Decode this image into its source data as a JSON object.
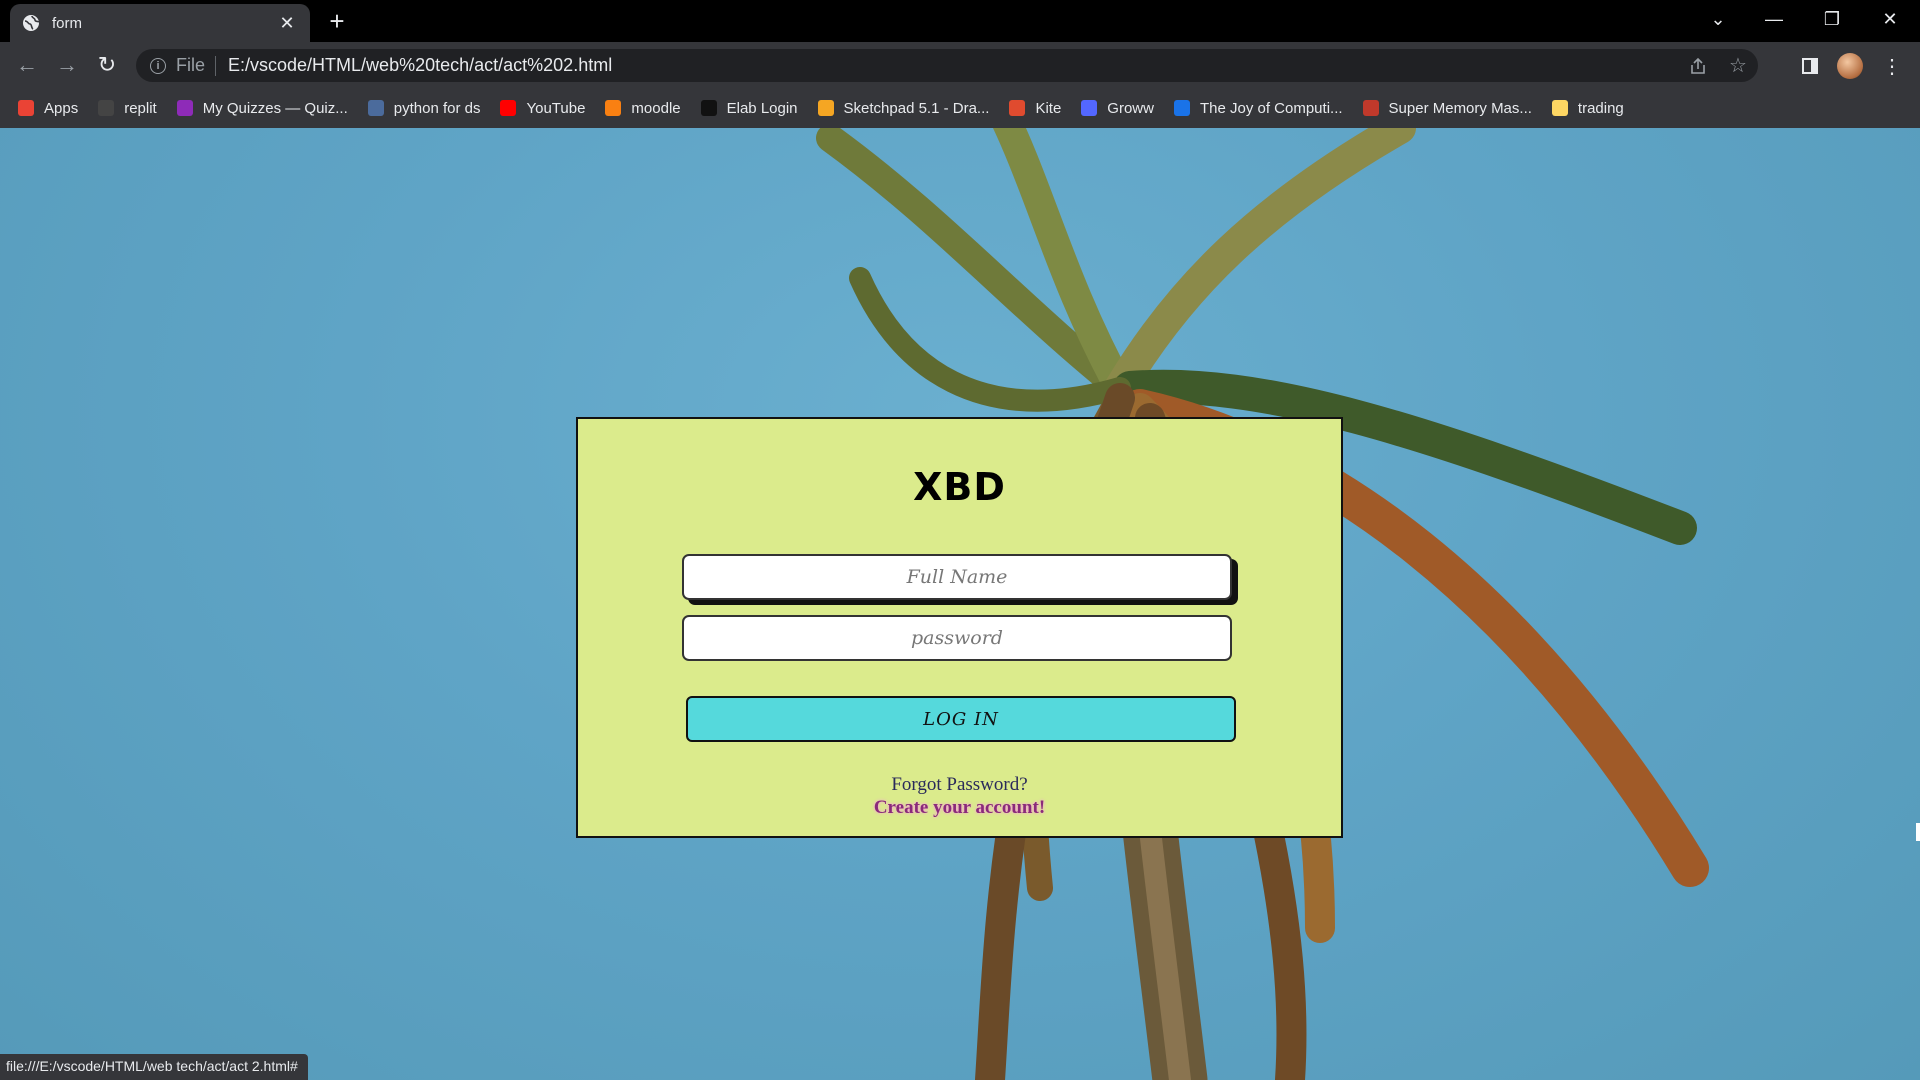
{
  "window": {
    "tab_title": "form",
    "tab_close": "✕",
    "new_tab": "+",
    "controls": {
      "tab_search": "⌄",
      "minimize": "—",
      "restore": "❐",
      "close": "✕"
    }
  },
  "toolbar": {
    "back": "←",
    "forward": "→",
    "reload": "↻",
    "scheme": "File",
    "url": "E:/vscode/HTML/web%20tech/act/act%202.html"
  },
  "bookmarks": [
    {
      "label": "Apps",
      "icon": "apps-grid-icon",
      "color": "#ea4335"
    },
    {
      "label": "replit",
      "icon": "replit-icon",
      "color": "#444"
    },
    {
      "label": "My Quizzes — Quiz...",
      "icon": "quizizz-icon",
      "color": "#8e2bb8"
    },
    {
      "label": "python for ds",
      "icon": "python-icon",
      "color": "#4b6b9c"
    },
    {
      "label": "YouTube",
      "icon": "youtube-icon",
      "color": "#ff0000"
    },
    {
      "label": "moodle",
      "icon": "moodle-icon",
      "color": "#f98012"
    },
    {
      "label": "Elab Login",
      "icon": "elab-icon",
      "color": "#111"
    },
    {
      "label": "Sketchpad 5.1 - Dra...",
      "icon": "sketchpad-icon",
      "color": "#f5a623"
    },
    {
      "label": "Kite",
      "icon": "kite-icon",
      "color": "#e04b2f"
    },
    {
      "label": "Groww",
      "icon": "groww-icon",
      "color": "#5367ff"
    },
    {
      "label": "The Joy of Computi...",
      "icon": "swayam-icon",
      "color": "#1a73e8"
    },
    {
      "label": "Super Memory Mas...",
      "icon": "memory-icon",
      "color": "#c0392b"
    },
    {
      "label": "trading",
      "icon": "folder-icon",
      "color": "#fdd663"
    }
  ],
  "form": {
    "title": "XBD",
    "name_placeholder": "Full Name",
    "password_placeholder": "password",
    "login_label": "LOG IN",
    "forgot_label": "Forgot Password?",
    "create_label": "Create your account!"
  },
  "status_url": "file:///E:/vscode/HTML/web tech/act/act 2.html#"
}
